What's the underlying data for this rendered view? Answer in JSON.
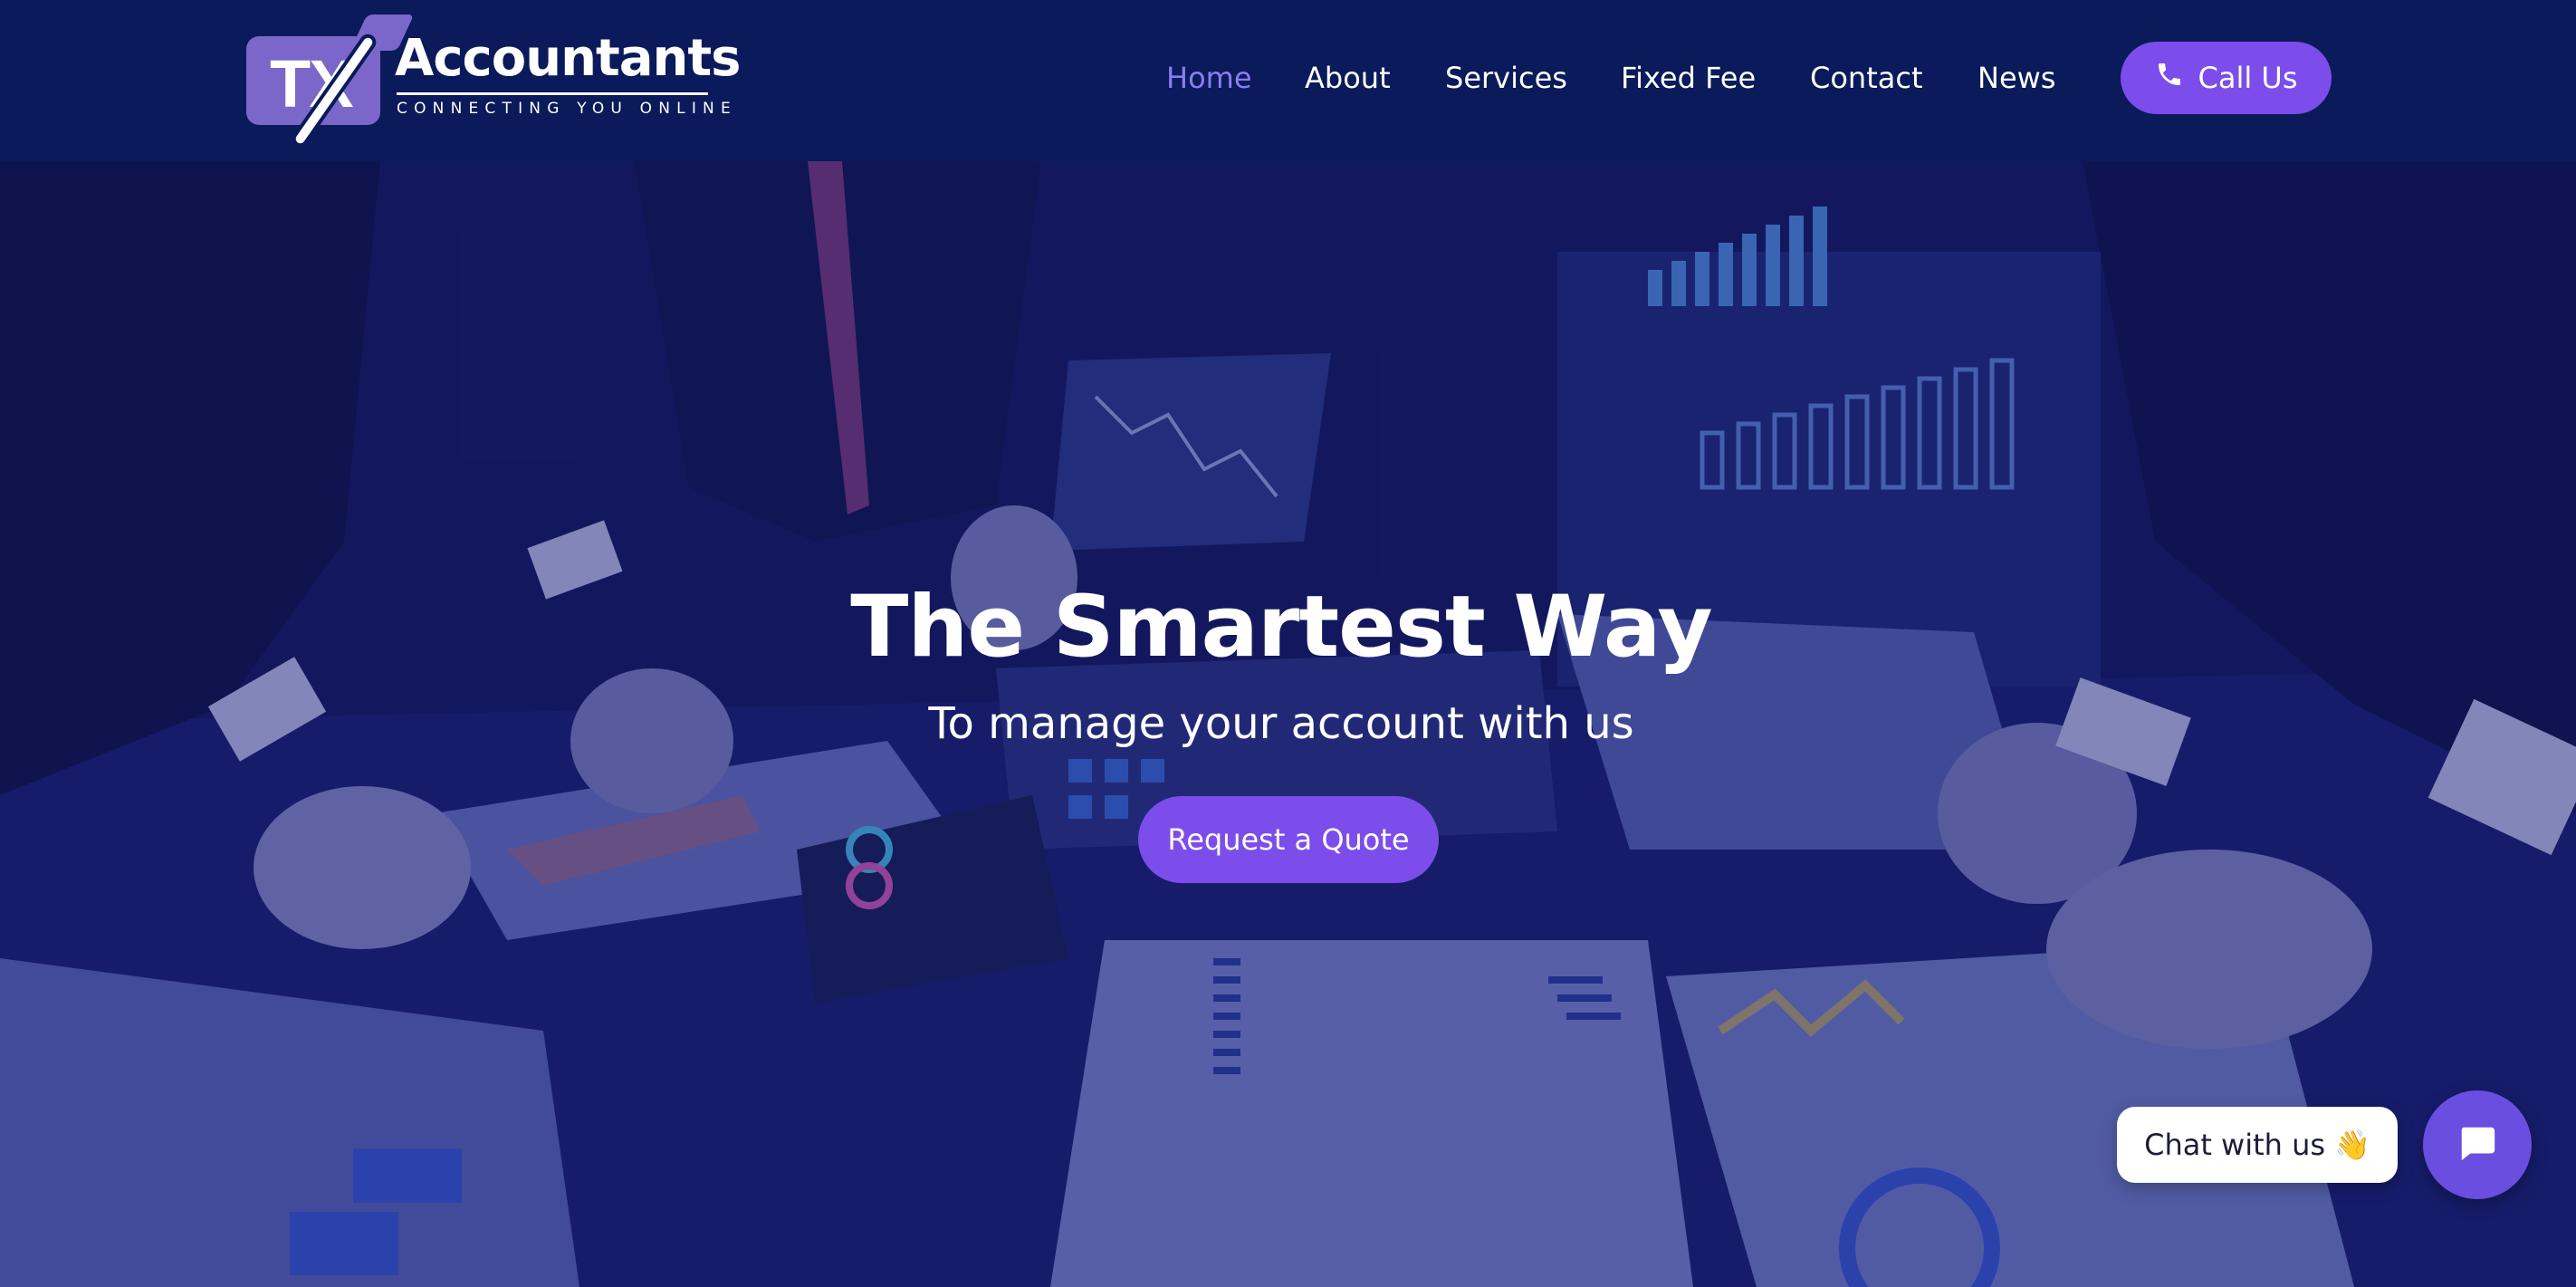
{
  "brand": {
    "logo_mark": "TX",
    "name": "Accountants",
    "tagline": "CONNECTING YOU ONLINE"
  },
  "nav": {
    "items": [
      {
        "label": "Home",
        "active": true
      },
      {
        "label": "About",
        "active": false
      },
      {
        "label": "Services",
        "active": false
      },
      {
        "label": "Fixed Fee",
        "active": false
      },
      {
        "label": "Contact",
        "active": false
      },
      {
        "label": "News",
        "active": false
      }
    ],
    "call_button": {
      "label": "Call Us",
      "icon": "phone-icon"
    }
  },
  "hero": {
    "title": "The Smartest Way",
    "subtitle": "To manage your account with us",
    "cta_label": "Request a Quote",
    "background": "business-meeting-charts-photo"
  },
  "chat": {
    "bubble_label": "Chat with us",
    "bubble_emoji": "👋",
    "button_icon": "chat-icon"
  },
  "colors": {
    "header_bg": "#0a1a5a",
    "accent": "#7c4dea",
    "active_nav": "#8c7cf0",
    "hero_tint": "#12165f"
  }
}
